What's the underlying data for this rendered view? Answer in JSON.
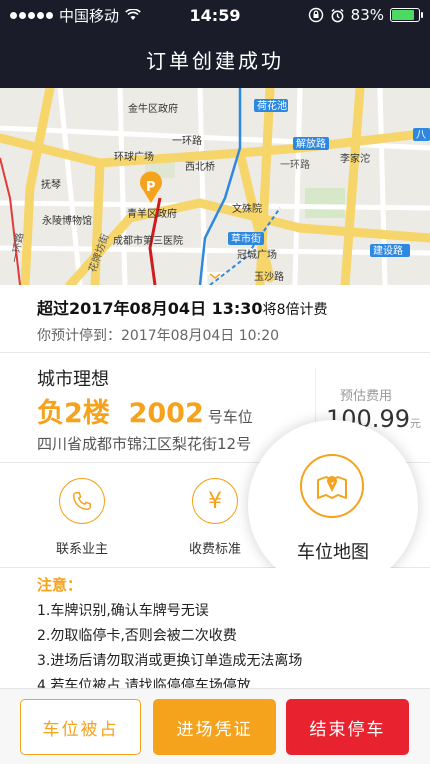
{
  "status": {
    "carrier": "中国移动",
    "time": "14:59",
    "battery": "83%",
    "battery_level": 0.83
  },
  "nav": {
    "title": "订单创建成功"
  },
  "map": {
    "labels": {
      "jinniu": "金牛区政府",
      "hehuachi": "荷花池",
      "yihuanlu_n": "一环路",
      "xibeiqiao": "西北桥",
      "huanqiu": "环球广场",
      "xiejiaxiang": "解放路",
      "lijiatuo": "李家沱",
      "fuqin": "抚琴",
      "huapailu": "花牌坊街",
      "yihuanlu_w": "一环路",
      "yihuanlu_e": "一环路",
      "wenshuyuan": "文殊院",
      "yongkang": "永陵博物馆",
      "qingyang": "青羊区政府",
      "caoshijie": "草市街",
      "cdthird": "成都市第三医院",
      "guanchengguangchang": "冠城广场",
      "jianshelu": "建设路",
      "yushalu": "玉沙路",
      "parking_marker": "P",
      "ba": "八"
    }
  },
  "fee": {
    "line1_prefix": "超过2017年08月04日 13:30",
    "line1_suffix": "将8倍计费",
    "line2": "你预计停到：2017年08月04日 10:20"
  },
  "lot": {
    "name": "城市理想",
    "spot": "负2楼  2002",
    "spot_suffix": "号车位",
    "address": "四川省成都市锦江区梨花街12号",
    "est_label": "预估费用",
    "est_value": "100.99",
    "est_unit": "元"
  },
  "actions": {
    "contact": "联系业主",
    "pricing": "收费标准",
    "map": "车位地图"
  },
  "notice": {
    "title": "注意：",
    "lines": [
      "1.车牌识别,确认车牌号无误",
      "2.勿取临停卡,否则会被二次收费",
      "3.进场后请勿取消或更换订单造成无法离场",
      "4.若车位被占,请找临停停车场停放"
    ]
  },
  "buttons": {
    "occupied": "车位被占",
    "voucher": "进场凭证",
    "end": "结束停车"
  },
  "colors": {
    "accent": "#f5a21c",
    "danger": "#e8232f",
    "nav_bg": "#1b1c2a"
  }
}
